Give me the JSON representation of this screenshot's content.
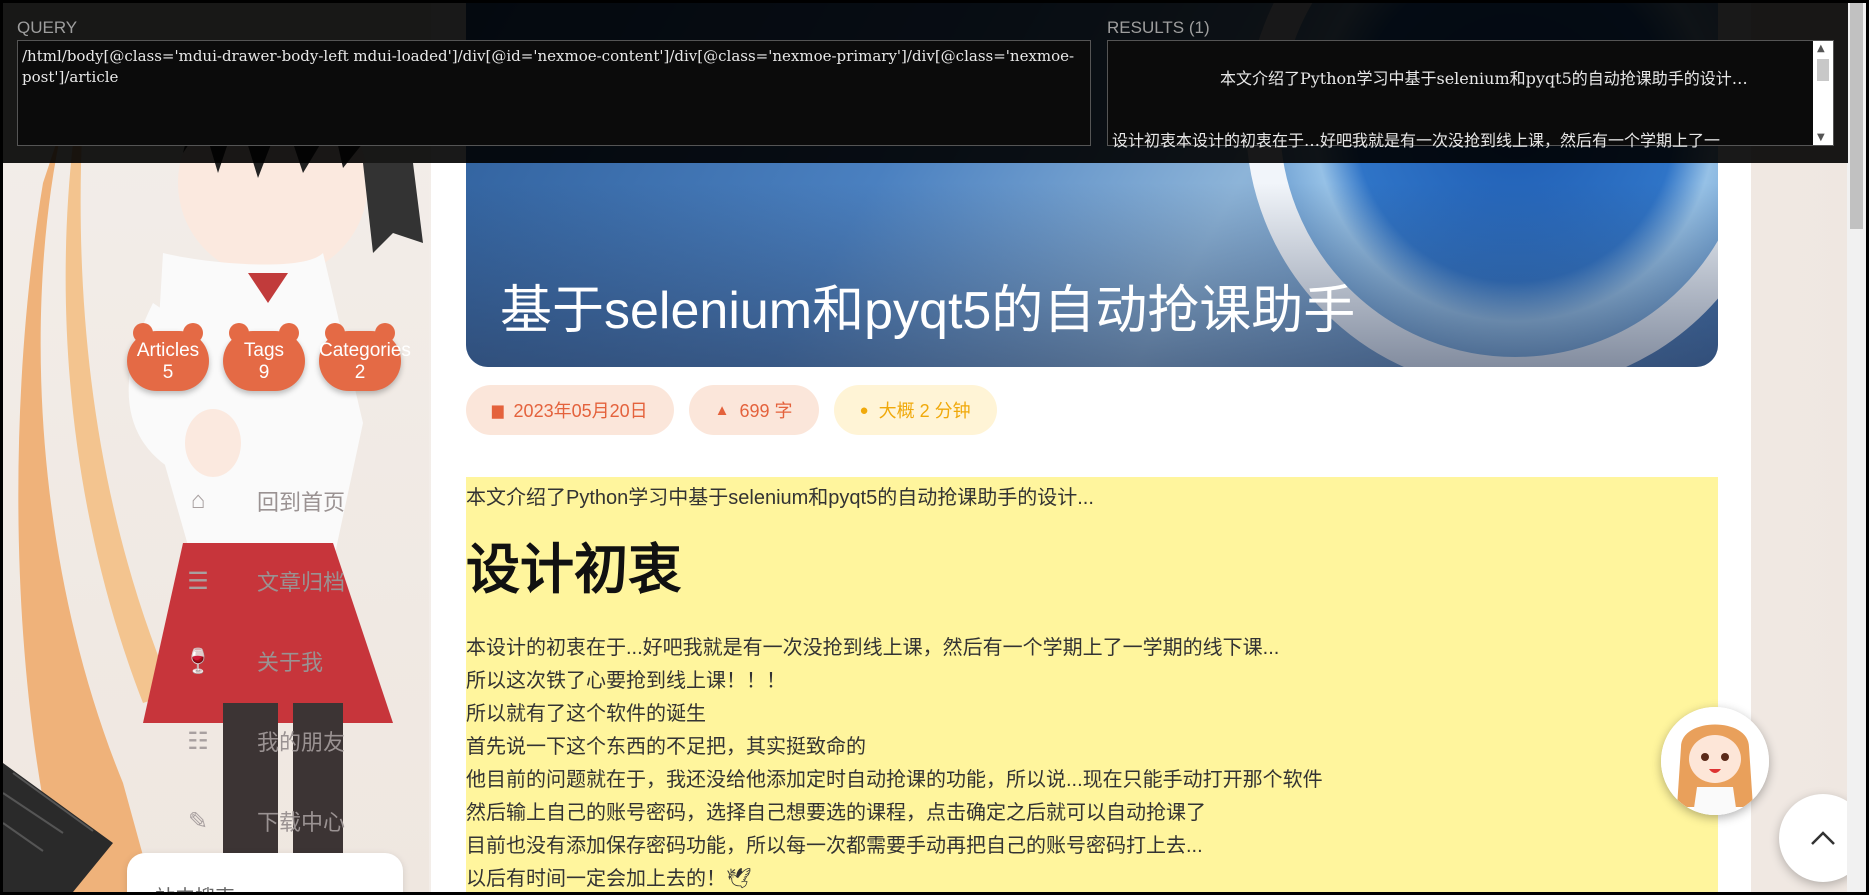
{
  "overlay": {
    "query_label": "QUERY",
    "query_text": "/html/body[@class='mdui-drawer-body-left mdui-loaded']/div[@id='nexmoe-content']/div[@class='nexmoe-primary']/div[@class='nexmoe-post']/article",
    "results_label": "RESULTS (1)",
    "result_line1": "本文介绍了Python学习中基于selenium和pyqt5的自动抢课助手的设计…",
    "result_line2": "设计初衷本设计的初衷在于…好吧我就是有一次没抢到线上课，然后有一个学期上了一"
  },
  "drawer": {
    "stats": [
      {
        "label": "Articles",
        "value": "5"
      },
      {
        "label": "Tags",
        "value": "9"
      },
      {
        "label": "Categories",
        "value": "2"
      }
    ],
    "menu": [
      {
        "icon": "home-icon",
        "label": "回到首页"
      },
      {
        "icon": "archive-icon",
        "label": "文章归档"
      },
      {
        "icon": "glass-icon",
        "label": "关于我"
      },
      {
        "icon": "friends-icon",
        "label": "我的朋友"
      },
      {
        "icon": "download-icon",
        "label": "下载中心"
      }
    ],
    "search_title": "站内搜索"
  },
  "post": {
    "title": "基于selenium和pyqt5的自动抢课助手",
    "date": "2023年05月20日",
    "words": "699 字",
    "reading_time": "大概 2 分钟",
    "intro": "本文介绍了Python学习中基于selenium和pyqt5的自动抢课助手的设计...",
    "heading": "设计初衷",
    "lines": [
      "本设计的初衷在于...好吧我就是有一次没抢到线上课，然后有一个学期上了一学期的线下课...",
      "所以这次铁了心要抢到线上课！！！",
      "所以就有了这个软件的诞生",
      "首先说一下这个东西的不足把，其实挺致命的",
      "他目前的问题就在于，我还没给他添加定时自动抢课的功能，所以说...现在只能手动打开那个软件",
      "然后输上自己的账号密码，选择自己想要选的课程，点击确定之后就可以自动抢课了",
      "目前也没有添加保存密码功能，所以每一次都需要手动再把自己的账号密码打上去...",
      "以后有时间一定会加上去的！🕊"
    ]
  },
  "colors": {
    "accent": "#e46a45",
    "highlight": "#fff59d",
    "chip_time": "#f0a90b"
  }
}
